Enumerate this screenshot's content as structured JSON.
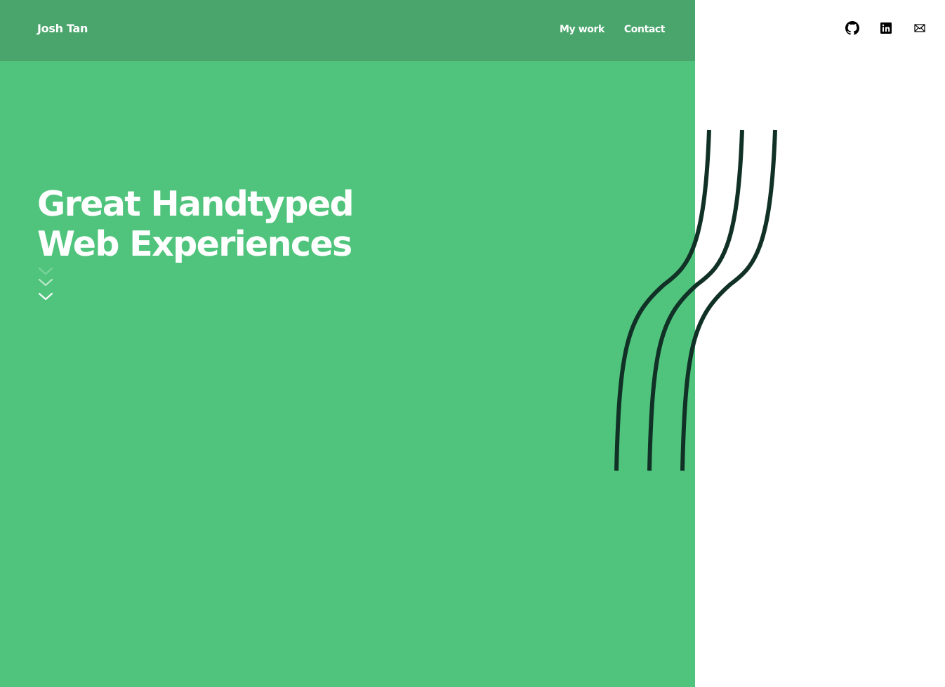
{
  "header": {
    "brand": "Josh Tan",
    "nav": [
      {
        "label": "My work"
      },
      {
        "label": "Contact"
      }
    ]
  },
  "hero": {
    "title_lines": [
      "Great Handtyped",
      "Web Experiences"
    ]
  },
  "icons": {
    "scroll_down": "chevrons-down-icon",
    "social": [
      "github-icon",
      "linkedin-icon",
      "mail-icon"
    ],
    "decoration": "wavy-lines-graphic"
  },
  "colors": {
    "hero_green": "#50c47c",
    "header_green": "#4aa56c",
    "line_dark": "#113127",
    "white": "#ffffff"
  }
}
